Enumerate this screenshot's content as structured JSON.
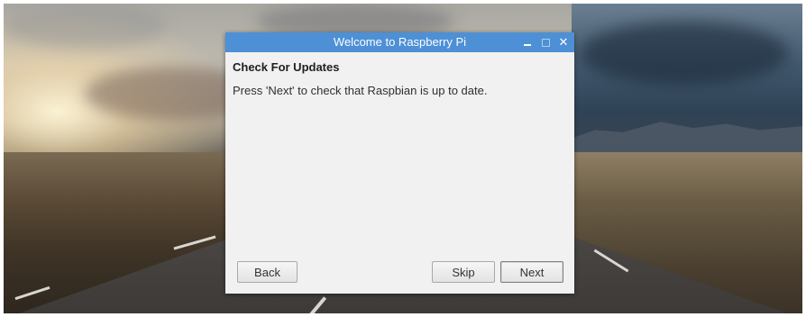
{
  "dialog": {
    "title": "Welcome to Raspberry Pi",
    "heading": "Check For Updates",
    "description": "Press 'Next' to check that Raspbian is up to date.",
    "buttons": {
      "back": "Back",
      "skip": "Skip",
      "next": "Next"
    },
    "window_controls": [
      "minimize-icon",
      "maximize-icon",
      "close-icon"
    ]
  },
  "colors": {
    "titlebar": "#4d90d6",
    "dialog_bg": "#f1f1f1"
  }
}
